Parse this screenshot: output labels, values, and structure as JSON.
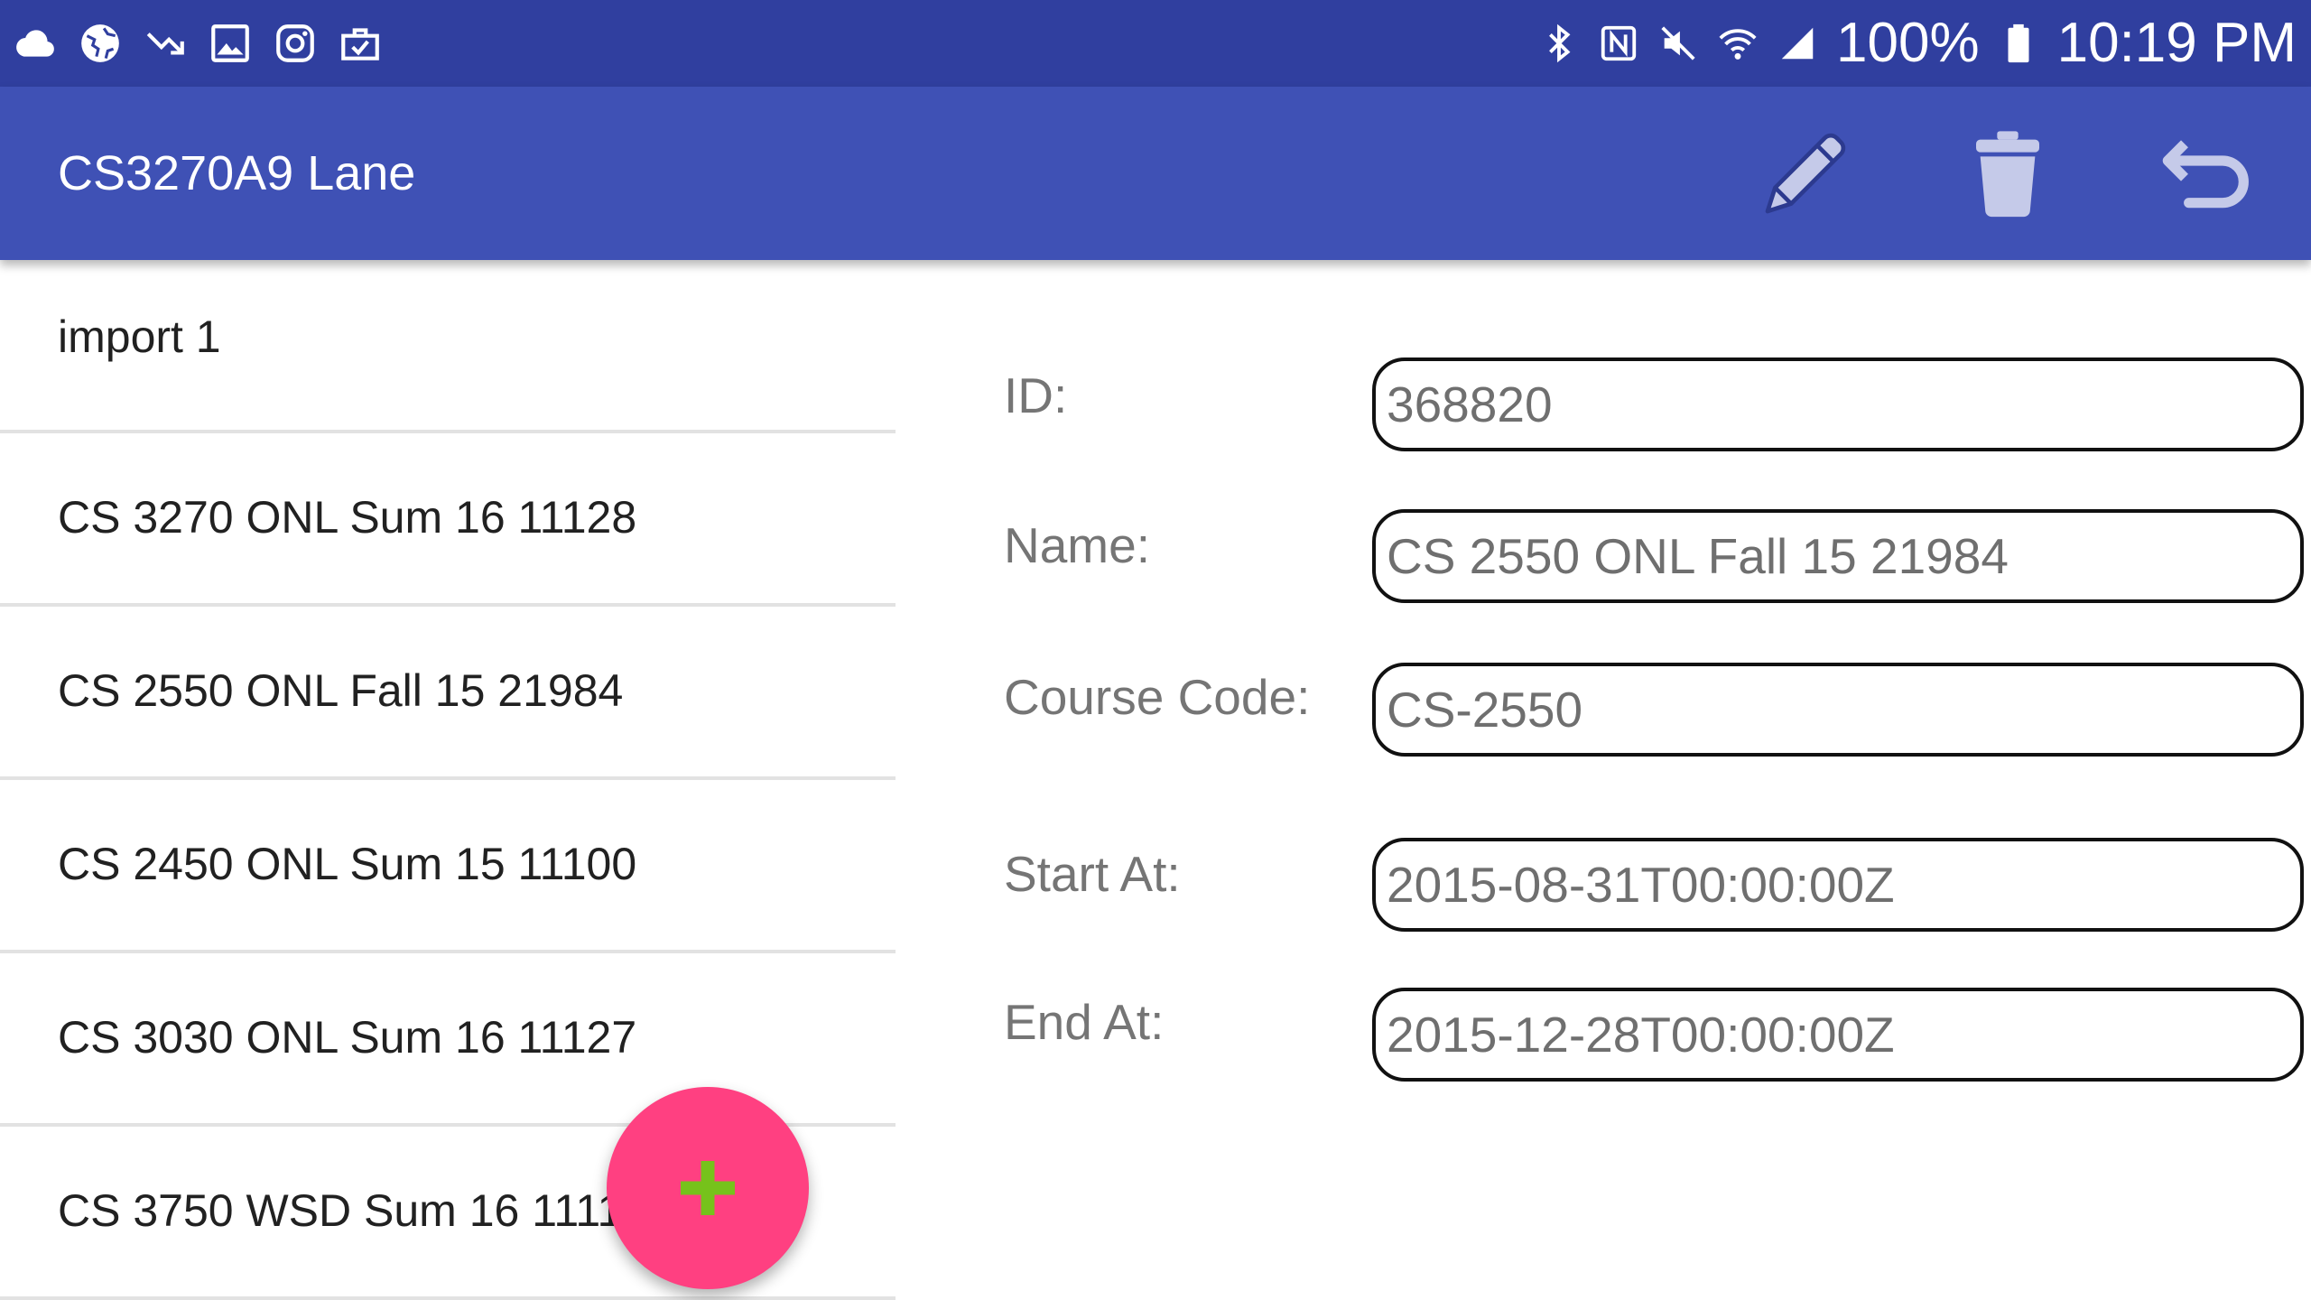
{
  "status_bar": {
    "left_icons": [
      "cloud-icon",
      "globe-icon",
      "missed-call-icon",
      "gallery-icon",
      "instagram-icon",
      "briefcase-check-icon"
    ],
    "right_icons": [
      "bluetooth-icon",
      "nfc-icon",
      "mute-icon",
      "wifi-icon",
      "cellular-signal-icon"
    ],
    "battery": "100%",
    "battery_icon": "battery-full-icon",
    "time": "10:19 PM"
  },
  "app_bar": {
    "title": "CS3270A9 Lane",
    "actions": [
      {
        "icon": "pencil-icon",
        "name": "edit"
      },
      {
        "icon": "trash-icon",
        "name": "delete"
      },
      {
        "icon": "undo-icon",
        "name": "back"
      }
    ]
  },
  "list": {
    "items": [
      {
        "label": "import 1"
      },
      {
        "label": "CS 3270 ONL Sum 16 11128"
      },
      {
        "label": "CS 2550 ONL Fall 15 21984"
      },
      {
        "label": "CS 2450 ONL Sum 15 11100"
      },
      {
        "label": "CS 3030 ONL Sum 16 11127"
      },
      {
        "label": "CS 3750 WSD Sum 16 11119"
      }
    ]
  },
  "form": {
    "id_label": "ID:",
    "id_value": "368820",
    "name_label": "Name:",
    "name_value": "CS 2550 ONL Fall 15 21984",
    "course_code_label": "Course Code:",
    "course_code_value": "CS-2550",
    "start_label": "Start At:",
    "start_value": "2015-08-31T00:00:00Z",
    "end_label": "End At:",
    "end_value": "2015-12-28T00:00:00Z"
  },
  "fab": {
    "icon": "plus-icon"
  },
  "colors": {
    "status_bar": "#303F9F",
    "app_bar": "#3F51B5",
    "fab": "#FF4081",
    "fab_icon": "#76C21B",
    "action_icons": "#C5CAE9"
  }
}
